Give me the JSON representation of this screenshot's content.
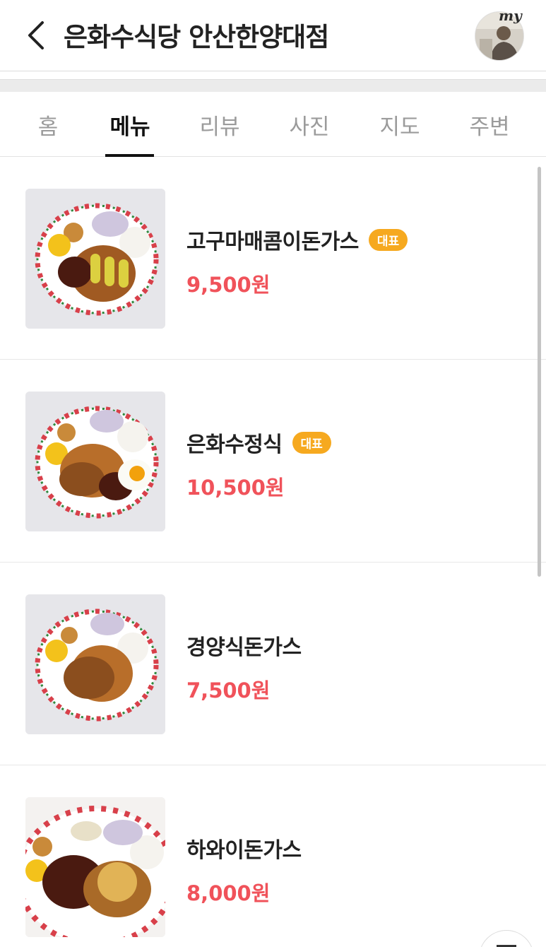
{
  "header": {
    "title": "은화수식당 안산한양대점",
    "avatar_badge": "my"
  },
  "tabs": [
    {
      "label": "홈",
      "active": false
    },
    {
      "label": "메뉴",
      "active": true
    },
    {
      "label": "리뷰",
      "active": false
    },
    {
      "label": "사진",
      "active": false
    },
    {
      "label": "지도",
      "active": false
    },
    {
      "label": "주변",
      "active": false
    }
  ],
  "menu": [
    {
      "name": "고구마매콤이돈가스",
      "badge": "대표",
      "price": "9,500원"
    },
    {
      "name": "은화수정식",
      "badge": "대표",
      "price": "10,500원"
    },
    {
      "name": "경양식돈가스",
      "badge": "",
      "price": "7,500원"
    },
    {
      "name": "하와이돈가스",
      "badge": "",
      "price": "8,000원"
    }
  ],
  "colors": {
    "price": "#f0525a",
    "badge": "#f6a91f",
    "active_tab": "#111111",
    "inactive_tab": "#9b9b9b"
  }
}
